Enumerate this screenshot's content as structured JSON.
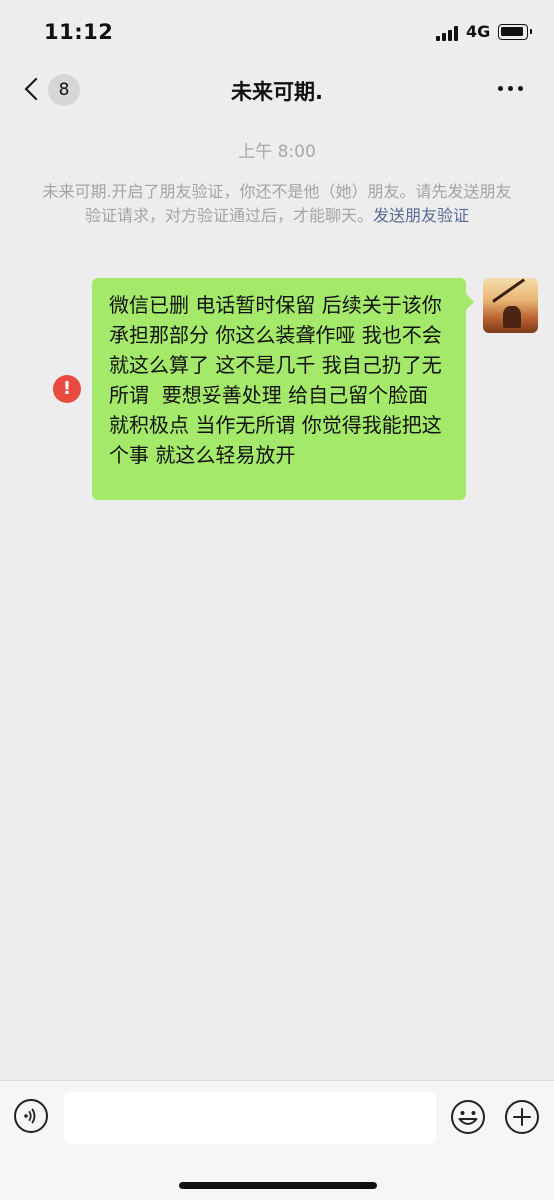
{
  "status_bar": {
    "time": "11:12",
    "network": "4G"
  },
  "nav": {
    "unread_count": "8",
    "title": "未来可期."
  },
  "chat": {
    "timestamp": "上午 8:00",
    "system_notice": "未来可期.开启了朋友验证，你还不是他（她）朋友。请先发送朋友验证请求，对方验证通过后，才能聊天。",
    "system_link": "发送朋友验证",
    "messages": [
      {
        "sender": "me",
        "status": "failed",
        "text": "微信已删 电话暂时保留 后续关于该你承担那部分 你这么装聋作哑 我也不会就这么算了 这不是几千 我自己扔了无所谓  要想妥善处理 给自己留个脸面 就积极点 当作无所谓 你觉得我能把这个事 就这么轻易放开"
      }
    ],
    "error_symbol": "!"
  },
  "input_bar": {
    "value": "",
    "placeholder": ""
  },
  "colors": {
    "background": "#ededed",
    "bubble_green": "#a5e96a",
    "error_red": "#e94a3f",
    "link_blue": "#576b95"
  }
}
